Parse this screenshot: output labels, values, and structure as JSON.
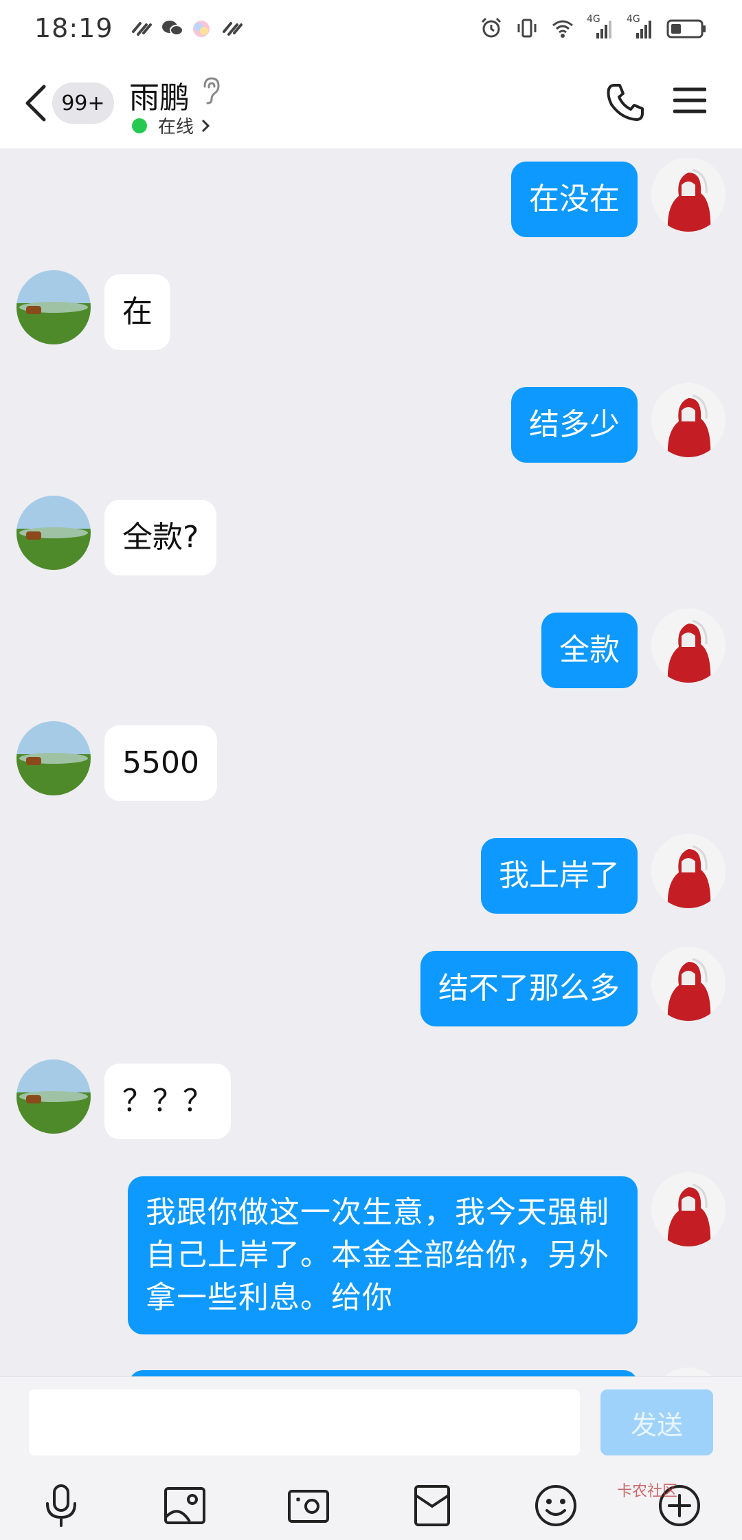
{
  "status_bar": {
    "time": "18:19",
    "network_label_1": "4G",
    "network_label_2": "4G"
  },
  "header": {
    "unread_badge": "99+",
    "contact_name": "雨鹏",
    "status_text": "在线",
    "status_color": "#26c94f"
  },
  "messages": [
    {
      "from": "me",
      "text": "在没在"
    },
    {
      "from": "other",
      "text": "在"
    },
    {
      "from": "me",
      "text": "结多少"
    },
    {
      "from": "other",
      "text": "全款?"
    },
    {
      "from": "me",
      "text": "全款"
    },
    {
      "from": "other",
      "text": "5500"
    },
    {
      "from": "me",
      "text": "我上岸了"
    },
    {
      "from": "me",
      "text": "结不了那么多"
    },
    {
      "from": "other",
      "text": "？？？"
    },
    {
      "from": "me",
      "text": "我跟你做这一次生意，我今天强制自己上岸了。本金全部给你，另外拿一些利息。给你"
    }
  ],
  "input": {
    "placeholder": "",
    "send_label": "发送"
  },
  "toolbar": {
    "icons": [
      "microphone-icon",
      "image-icon",
      "camera-icon",
      "red-packet-icon",
      "emoji-icon",
      "plus-icon"
    ]
  },
  "watermark": "卡农社区",
  "colors": {
    "my_bubble": "#0d99ff",
    "other_bubble": "#ffffff",
    "background": "#ededf2",
    "send_button_disabled": "#9fd2fb"
  }
}
